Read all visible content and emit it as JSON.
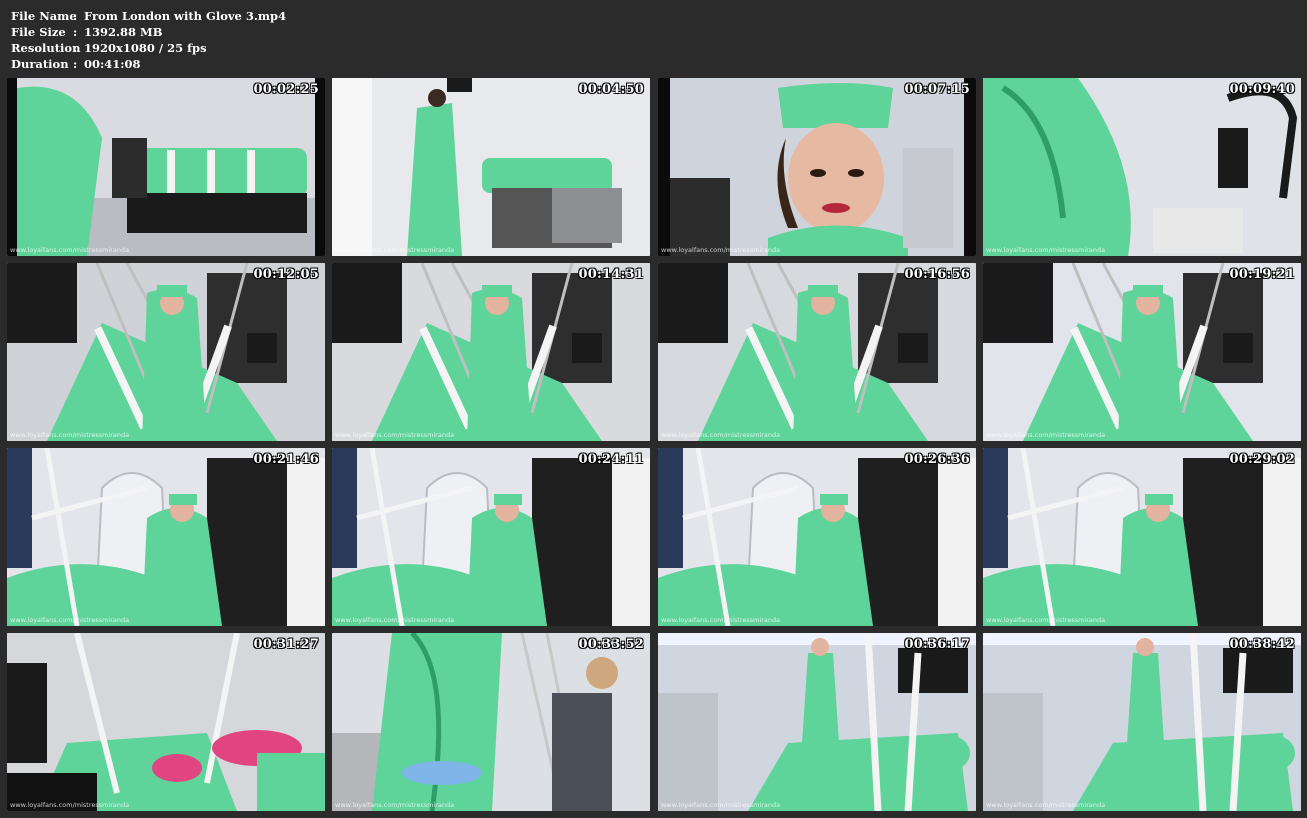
{
  "file_info": [
    {
      "label": "File Name",
      "value": "From London with Glove 3.mp4"
    },
    {
      "label": "File Size",
      "value": "1392.88 MB"
    },
    {
      "label": "Resolution",
      "value": "1920x1080 / 25 fps"
    },
    {
      "label": "Duration",
      "value": "00:41:08"
    }
  ],
  "separator": ":",
  "watermark": "www.loyalfans.com/mistressmiranda",
  "thumbnails": [
    {
      "timestamp": "00:02:25",
      "scene": "medical-bed",
      "bg": "#d9dbe0",
      "frame": "#0b0b0b"
    },
    {
      "timestamp": "00:04:50",
      "scene": "camera-stand",
      "bg": "#e8e9ec",
      "frame": "#e8e9ec"
    },
    {
      "timestamp": "00:07:15",
      "scene": "closeup",
      "bg": "#cfd3db",
      "frame": "#0b0b0b"
    },
    {
      "timestamp": "00:09:40",
      "scene": "sleeve",
      "bg": "#dfe2e6",
      "frame": "#e0e2e6"
    },
    {
      "timestamp": "00:12:05",
      "scene": "sling",
      "bg": "#cfd2d6",
      "frame": "#cfd2d6"
    },
    {
      "timestamp": "00:14:31",
      "scene": "sling",
      "bg": "#d8dade",
      "frame": "#d8dade"
    },
    {
      "timestamp": "00:16:56",
      "scene": "sling",
      "bg": "#d6d9de",
      "frame": "#d6d9de"
    },
    {
      "timestamp": "00:19:21",
      "scene": "room",
      "bg": "#e1e4ea",
      "frame": "#e1e4ea"
    },
    {
      "timestamp": "00:21:46",
      "scene": "throne",
      "bg": "#e3e5ea",
      "frame": "#e3e5ea"
    },
    {
      "timestamp": "00:24:11",
      "scene": "throne",
      "bg": "#e3e5ea",
      "frame": "#e3e5ea"
    },
    {
      "timestamp": "00:26:36",
      "scene": "throne",
      "bg": "#e3e5ea",
      "frame": "#e3e5ea"
    },
    {
      "timestamp": "00:29:02",
      "scene": "throne",
      "bg": "#e3e5ea",
      "frame": "#e3e5ea"
    },
    {
      "timestamp": "00:31:27",
      "scene": "gloves",
      "bg": "#d5d7db",
      "frame": "#d5d7db"
    },
    {
      "timestamp": "00:33:52",
      "scene": "standing",
      "bg": "#dcdfe4",
      "frame": "#dcdfe4"
    },
    {
      "timestamp": "00:36:17",
      "scene": "wide",
      "bg": "#cfd6e0",
      "frame": "#cfd6e0"
    },
    {
      "timestamp": "00:38:42",
      "scene": "wide",
      "bg": "#cfd6e0",
      "frame": "#cfd6e0"
    }
  ],
  "colors": {
    "page_bg": "#2b2b2b",
    "latex_green": "#5ed39a",
    "latex_dark": "#2e9e67",
    "strap_white": "#f4f4f4",
    "equipment_black": "#1a1a1a"
  }
}
